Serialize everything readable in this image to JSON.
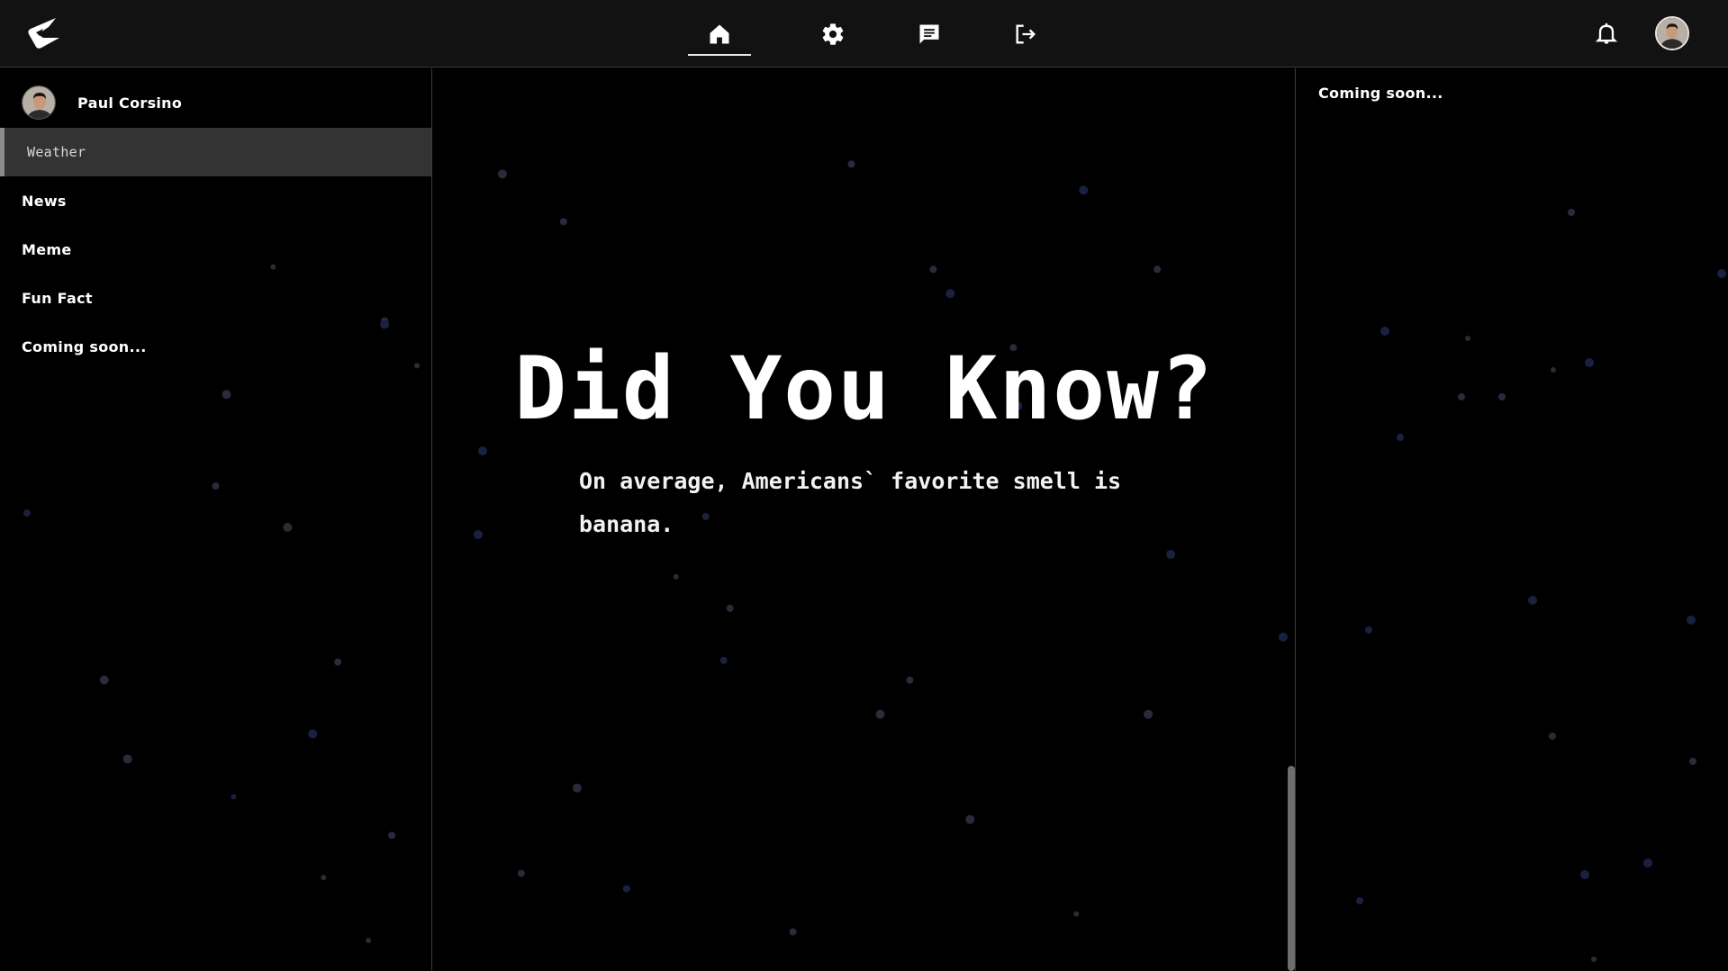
{
  "colors": {
    "background": "#000000",
    "topbar": "#121212",
    "sidebar_active": "#333333",
    "text": "#ffffff"
  },
  "topbar": {
    "logo": "app-logo",
    "nav": [
      {
        "icon": "home-icon",
        "active": true
      },
      {
        "icon": "gear-icon",
        "active": false
      },
      {
        "icon": "chat-icon",
        "active": false
      },
      {
        "icon": "logout-icon",
        "active": false
      }
    ],
    "notifications_icon": "bell-icon",
    "avatar": "user-avatar"
  },
  "sidebar": {
    "user_name": "Paul Corsino",
    "items": [
      {
        "label": "Weather",
        "active": true
      },
      {
        "label": "News",
        "active": false
      },
      {
        "label": "Meme",
        "active": false
      },
      {
        "label": "Fun Fact",
        "active": false
      },
      {
        "label": "Coming soon...",
        "active": false
      }
    ]
  },
  "main": {
    "headline": "Did You Know?",
    "fact": "On average, Americans` favorite smell is banana."
  },
  "right_panel": {
    "text": "Coming soon..."
  }
}
